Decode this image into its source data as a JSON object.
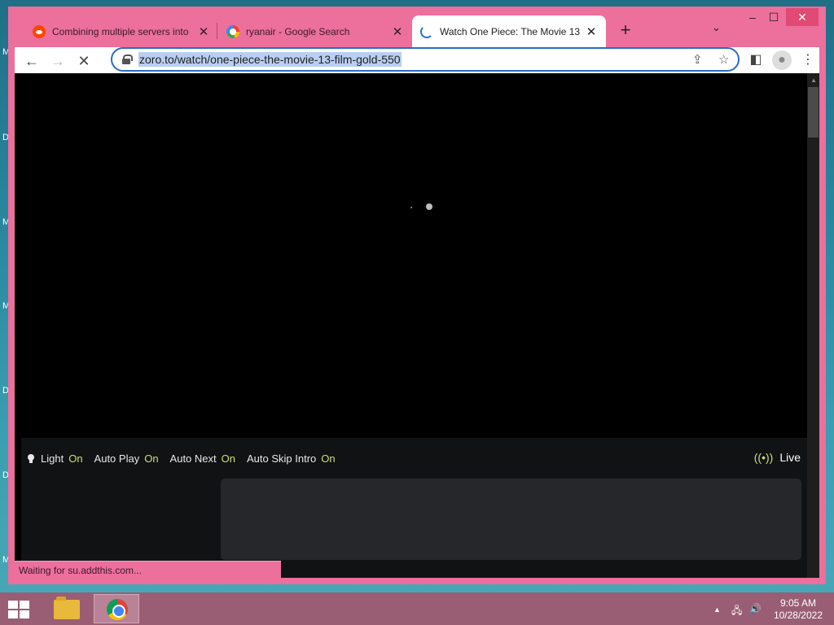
{
  "desktop": {
    "edge_glyphs": [
      "M",
      "D",
      "M",
      "D",
      "M",
      "D",
      "M"
    ]
  },
  "tabs": [
    {
      "title": "Combining multiple servers into",
      "favicon": "reddit-icon",
      "close": "✕"
    },
    {
      "title": "ryanair - Google Search",
      "favicon": "google-icon",
      "close": "✕"
    },
    {
      "title": "Watch One Piece: The Movie 13",
      "favicon": "loading-spinner-icon",
      "close": "✕"
    }
  ],
  "newtab_label": "+",
  "tab_search_glyph": "⌄",
  "window_controls": {
    "minimize": "–",
    "maximize": "☐",
    "close": "✕"
  },
  "toolbar": {
    "back": "←",
    "forward": "→",
    "stop": "✕",
    "url": "zoro.to/watch/one-piece-the-movie-13-film-gold-550",
    "share": "⇪",
    "bookmark": "☆",
    "sidepanel": "◧",
    "profile": "●",
    "menu": "⋮"
  },
  "player": {
    "controls": [
      {
        "label": "Light",
        "state": "On"
      },
      {
        "label": "Auto Play",
        "state": "On"
      },
      {
        "label": "Auto Next",
        "state": "On"
      },
      {
        "label": "Auto Skip Intro",
        "state": "On"
      }
    ],
    "live_label": "Live",
    "live_icon": "((•))"
  },
  "status_text": "Waiting for su.addthis.com...",
  "taskbar": {
    "tray": {
      "chevron": "▲",
      "network": "🖧",
      "volume": "🔊"
    },
    "time": "9:05 AM",
    "date": "10/28/2022"
  }
}
